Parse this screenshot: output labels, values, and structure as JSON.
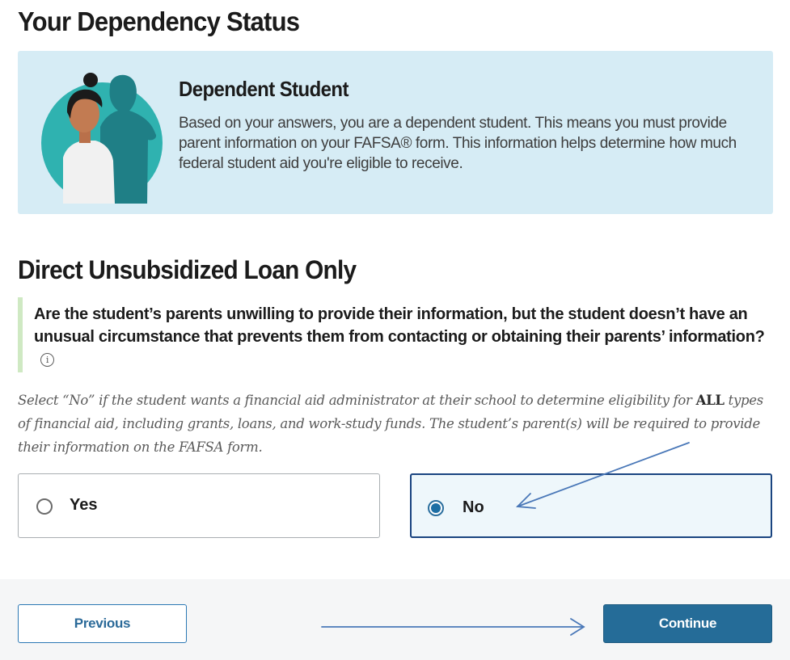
{
  "page": {
    "title": "Your Dependency Status"
  },
  "status_card": {
    "heading": "Dependent Student",
    "body": "Based on your answers, you are a dependent student. This means you must provide parent information on your FAFSA® form. This information helps determine how much federal student aid you're eligible to receive.",
    "illustration": "student-with-parent-silhouette"
  },
  "section": {
    "title": "Direct Unsubsidized Loan Only",
    "question": "Are the student’s parents unwilling to provide their information, but the student doesn’t have an unusual circumstance that prevents them from contacting or obtaining their parents’ information?",
    "info_icon": "info-icon",
    "hint_before": "Select “No” if the student wants a financial aid administrator at their school to determine eligibility for ",
    "hint_bold": "ALL",
    "hint_after": " types of financial aid, including grants, loans, and work-study funds. The student’s parent(s) will be required to provide their information on the FAFSA form."
  },
  "options": {
    "yes_label": "Yes",
    "no_label": "No",
    "selected": "No"
  },
  "footer": {
    "previous_label": "Previous",
    "continue_label": "Continue"
  },
  "colors": {
    "card_bg": "#d6ecf5",
    "selected_border": "#1a4480",
    "primary_button": "#256c98",
    "annotation_arrow": "#4a78b8"
  }
}
